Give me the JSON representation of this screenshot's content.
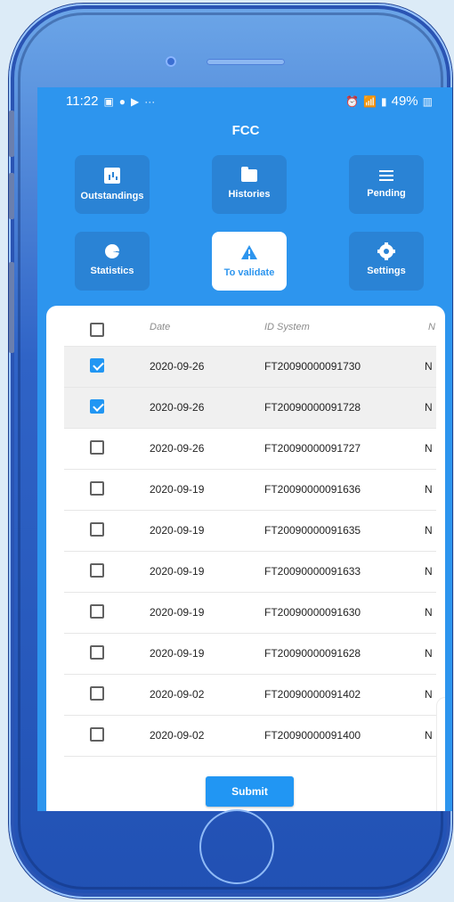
{
  "status_bar": {
    "time": "11:22",
    "left_icons": [
      "gallery-icon",
      "facebook-icon",
      "youtube-icon",
      "more-icon"
    ],
    "more_text": "···",
    "right_icons": [
      "alarm-icon",
      "wifi-icon",
      "signal-icon",
      "battery-icon"
    ],
    "battery": "49%"
  },
  "app": {
    "title": "FCC"
  },
  "nav": [
    {
      "label": "Outstandings",
      "icon": "bar-chart-icon",
      "active": false
    },
    {
      "label": "Histories",
      "icon": "folder-icon",
      "active": false
    },
    {
      "label": "Pending",
      "icon": "list-icon",
      "active": false
    },
    {
      "label": "Statistics",
      "icon": "pie-chart-icon",
      "active": false
    },
    {
      "label": "To validate",
      "icon": "warning-icon",
      "active": true
    },
    {
      "label": "Settings",
      "icon": "settings-icon",
      "active": false
    }
  ],
  "table": {
    "columns": [
      "Date",
      "ID System",
      "N"
    ],
    "rows": [
      {
        "date": "2020-09-26",
        "id": "FT20090000091730",
        "extra": "N",
        "checked": true
      },
      {
        "date": "2020-09-26",
        "id": "FT20090000091728",
        "extra": "N",
        "checked": true
      },
      {
        "date": "2020-09-26",
        "id": "FT20090000091727",
        "extra": "N",
        "checked": false
      },
      {
        "date": "2020-09-19",
        "id": "FT20090000091636",
        "extra": "N",
        "checked": false
      },
      {
        "date": "2020-09-19",
        "id": "FT20090000091635",
        "extra": "N",
        "checked": false
      },
      {
        "date": "2020-09-19",
        "id": "FT20090000091633",
        "extra": "N",
        "checked": false
      },
      {
        "date": "2020-09-19",
        "id": "FT20090000091630",
        "extra": "N",
        "checked": false
      },
      {
        "date": "2020-09-19",
        "id": "FT20090000091628",
        "extra": "N",
        "checked": false
      },
      {
        "date": "2020-09-02",
        "id": "FT20090000091402",
        "extra": "N",
        "checked": false
      },
      {
        "date": "2020-09-02",
        "id": "FT20090000091400",
        "extra": "N",
        "checked": false
      }
    ],
    "submit_label": "Submit"
  },
  "colors": {
    "primary": "#2d95ee",
    "accent": "#2196f3",
    "phone_body": "#2f63c6"
  }
}
